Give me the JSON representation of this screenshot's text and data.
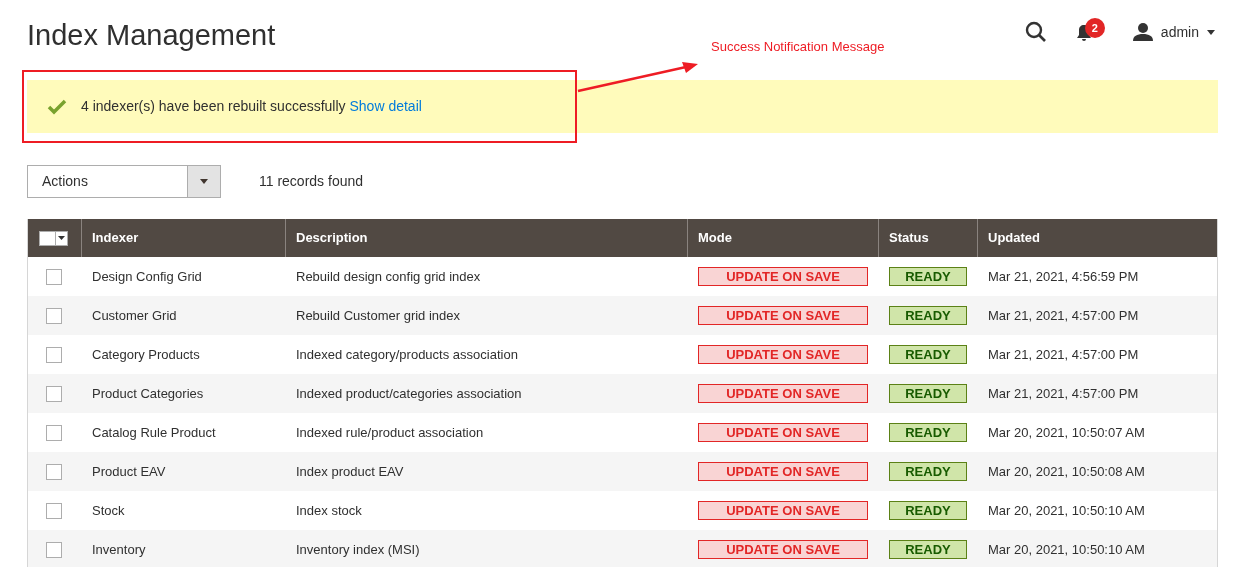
{
  "page_title": "Index Management",
  "header": {
    "notification_count": "2",
    "user": "admin"
  },
  "annotation": {
    "label": "Success Notification Message"
  },
  "message": {
    "text": "4 indexer(s) have been rebuilt successfully",
    "link": "Show detail"
  },
  "toolbar": {
    "actions": "Actions",
    "records": "11 records found"
  },
  "table": {
    "mass_select": {
      "checked": false
    },
    "columns": [
      "Indexer",
      "Description",
      "Mode",
      "Status",
      "Updated"
    ],
    "rows": [
      {
        "checked": false,
        "indexer": "Design Config Grid",
        "description": "Rebuild design config grid index",
        "mode": {
          "text": "UPDATE ON SAVE",
          "kind": "warning"
        },
        "status": {
          "text": "READY",
          "kind": "ok"
        },
        "updated": "Mar 21, 2021, 4:56:59 PM"
      },
      {
        "checked": false,
        "indexer": "Customer Grid",
        "description": "Rebuild Customer grid index",
        "mode": {
          "text": "UPDATE ON SAVE",
          "kind": "warning"
        },
        "status": {
          "text": "READY",
          "kind": "ok"
        },
        "updated": "Mar 21, 2021, 4:57:00 PM"
      },
      {
        "checked": false,
        "indexer": "Category Products",
        "description": "Indexed category/products association",
        "mode": {
          "text": "UPDATE ON SAVE",
          "kind": "warning"
        },
        "status": {
          "text": "READY",
          "kind": "ok"
        },
        "updated": "Mar 21, 2021, 4:57:00 PM"
      },
      {
        "checked": false,
        "indexer": "Product Categories",
        "description": "Indexed product/categories association",
        "mode": {
          "text": "UPDATE ON SAVE",
          "kind": "warning"
        },
        "status": {
          "text": "READY",
          "kind": "ok"
        },
        "updated": "Mar 21, 2021, 4:57:00 PM"
      },
      {
        "checked": false,
        "indexer": "Catalog Rule Product",
        "description": "Indexed rule/product association",
        "mode": {
          "text": "UPDATE ON SAVE",
          "kind": "warning"
        },
        "status": {
          "text": "READY",
          "kind": "ok"
        },
        "updated": "Mar 20, 2021, 10:50:07 AM"
      },
      {
        "checked": false,
        "indexer": "Product EAV",
        "description": "Index product EAV",
        "mode": {
          "text": "UPDATE ON SAVE",
          "kind": "warning"
        },
        "status": {
          "text": "READY",
          "kind": "ok"
        },
        "updated": "Mar 20, 2021, 10:50:08 AM"
      },
      {
        "checked": false,
        "indexer": "Stock",
        "description": "Index stock",
        "mode": {
          "text": "UPDATE ON SAVE",
          "kind": "warning"
        },
        "status": {
          "text": "READY",
          "kind": "ok"
        },
        "updated": "Mar 20, 2021, 10:50:10 AM"
      },
      {
        "checked": false,
        "indexer": "Inventory",
        "description": "Inventory index (MSI)",
        "mode": {
          "text": "UPDATE ON SAVE",
          "kind": "warning"
        },
        "status": {
          "text": "READY",
          "kind": "ok"
        },
        "updated": "Mar 20, 2021, 10:50:10 AM"
      }
    ]
  }
}
